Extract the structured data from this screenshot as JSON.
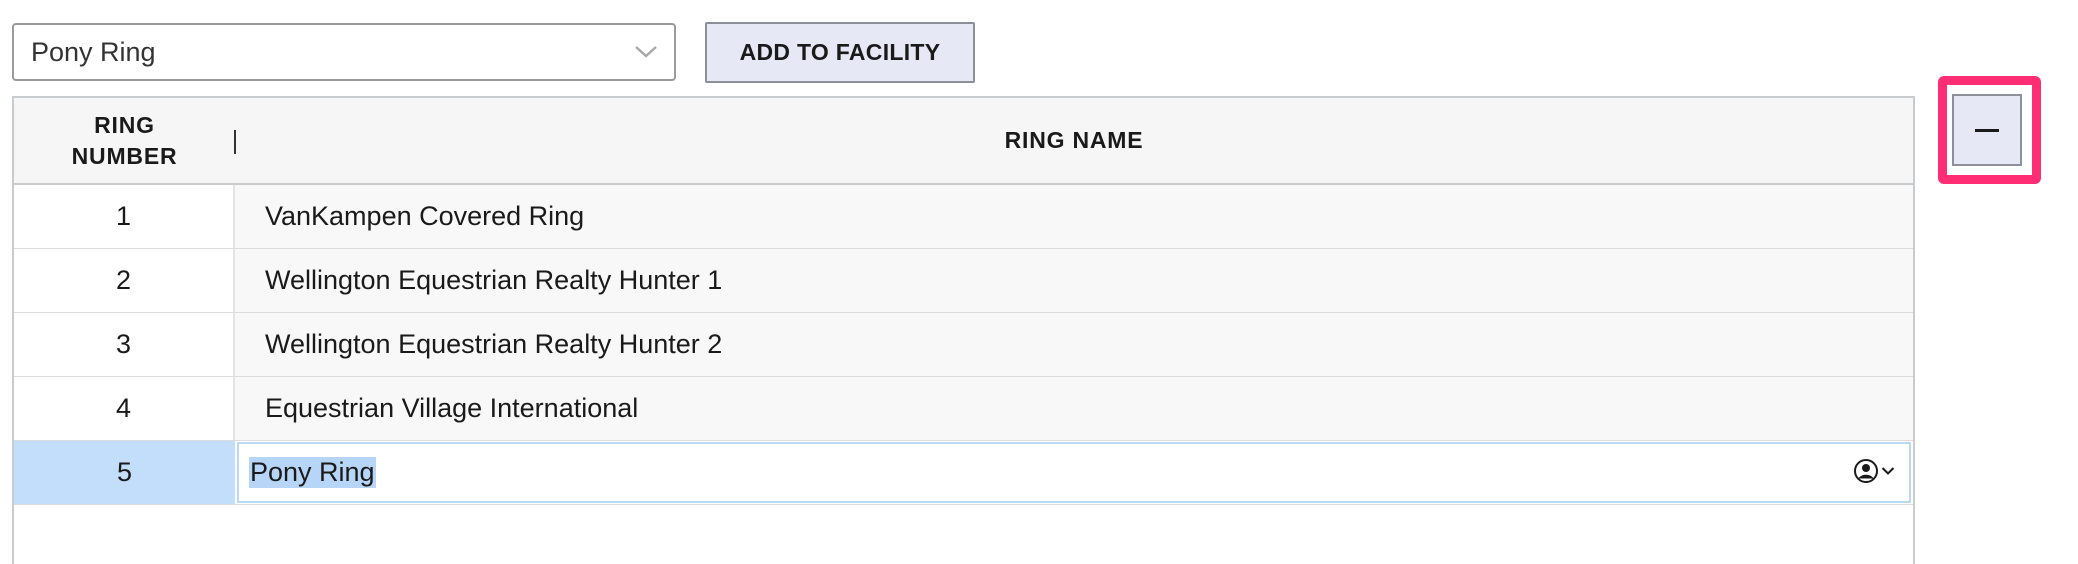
{
  "facility_select": {
    "selected": "Pony Ring",
    "icon": "chevron-down-icon"
  },
  "add_button": {
    "label": "ADD TO FACILITY"
  },
  "table": {
    "columns": [
      "RING NUMBER",
      "RING NAME"
    ],
    "rows": [
      {
        "number": "1",
        "name": "VanKampen Covered Ring"
      },
      {
        "number": "2",
        "name": "Wellington Equestrian Realty Hunter 1"
      },
      {
        "number": "3",
        "name": "Wellington Equestrian Realty Hunter 2"
      },
      {
        "number": "4",
        "name": "Equestrian Village International"
      },
      {
        "number": "5",
        "name": "Pony Ring"
      }
    ],
    "editing_row_index": 4,
    "autofill_icon": "contact-autofill-icon"
  },
  "remove_button": {
    "icon": "minus-icon"
  },
  "colors": {
    "highlight": "#ff2e74",
    "selection": "#c3defa",
    "button_bg": "#e6e8f5"
  }
}
